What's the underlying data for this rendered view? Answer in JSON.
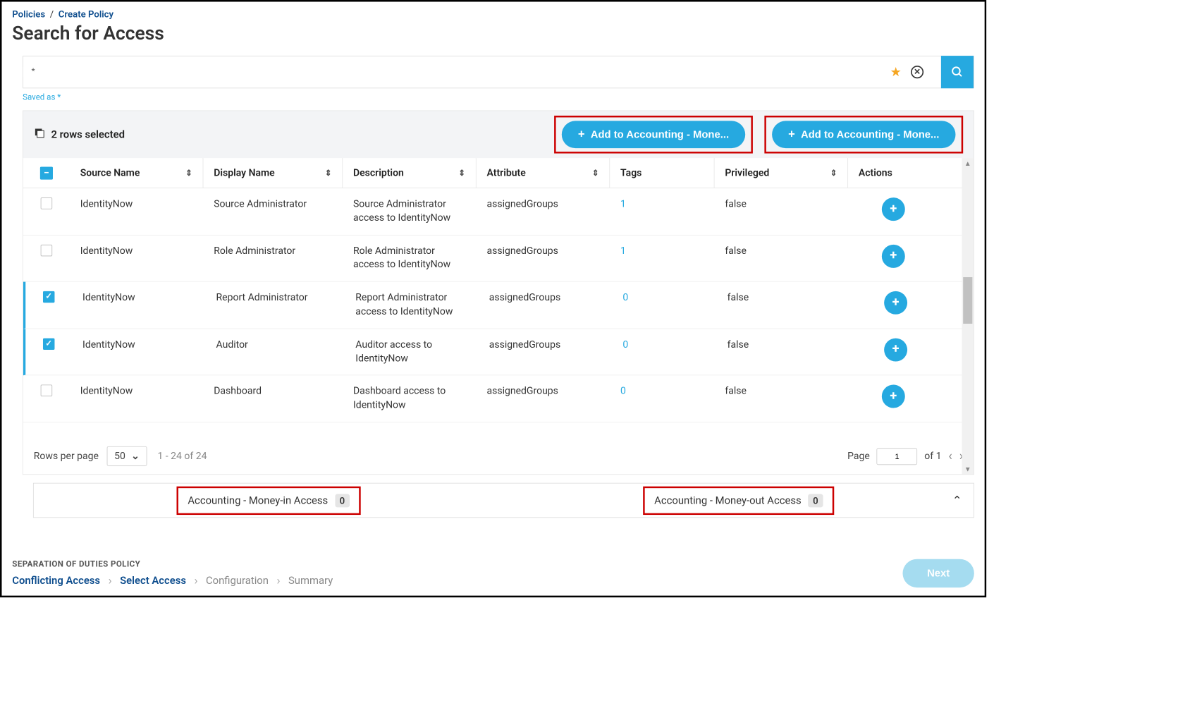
{
  "breadcrumb": {
    "parent": "Policies",
    "current": "Create Policy"
  },
  "page_title": "Search for Access",
  "search": {
    "value": "*",
    "saved_label": "Saved as *"
  },
  "toolbar": {
    "rows_selected": "2 rows selected",
    "add_btn1": "Add to Accounting - Mone...",
    "add_btn2": "Add to Accounting - Mone..."
  },
  "columns": {
    "source": "Source Name",
    "display": "Display Name",
    "desc": "Description",
    "attr": "Attribute",
    "tags": "Tags",
    "priv": "Privileged",
    "actions": "Actions"
  },
  "rows": [
    {
      "selected": false,
      "source": "IdentityNow",
      "display": "Source Administrator",
      "desc": "Source Administrator access to IdentityNow",
      "attr": "assignedGroups",
      "tags": "1",
      "priv": "false"
    },
    {
      "selected": false,
      "source": "IdentityNow",
      "display": "Role Administrator",
      "desc": "Role Administrator access to IdentityNow",
      "attr": "assignedGroups",
      "tags": "1",
      "priv": "false"
    },
    {
      "selected": true,
      "source": "IdentityNow",
      "display": "Report Administrator",
      "desc": "Report Administrator access to IdentityNow",
      "attr": "assignedGroups",
      "tags": "0",
      "priv": "false"
    },
    {
      "selected": true,
      "source": "IdentityNow",
      "display": "Auditor",
      "desc": "Auditor access to IdentityNow",
      "attr": "assignedGroups",
      "tags": "0",
      "priv": "false"
    },
    {
      "selected": false,
      "source": "IdentityNow",
      "display": "Dashboard",
      "desc": "Dashboard access to IdentityNow",
      "attr": "assignedGroups",
      "tags": "0",
      "priv": "false"
    }
  ],
  "pagination": {
    "rpp_label": "Rows per page",
    "rpp_value": "50",
    "range": "1 - 24 of 24",
    "page_label": "Page",
    "page_value": "1",
    "of_label": "of 1"
  },
  "summary": {
    "left_label": "Accounting - Money-in Access",
    "left_count": "0",
    "right_label": "Accounting - Money-out Access",
    "right_count": "0"
  },
  "footer": {
    "sod_label": "SEPARATION OF DUTIES POLICY",
    "steps": [
      "Conflicting Access",
      "Select Access",
      "Configuration",
      "Summary"
    ],
    "next": "Next"
  }
}
